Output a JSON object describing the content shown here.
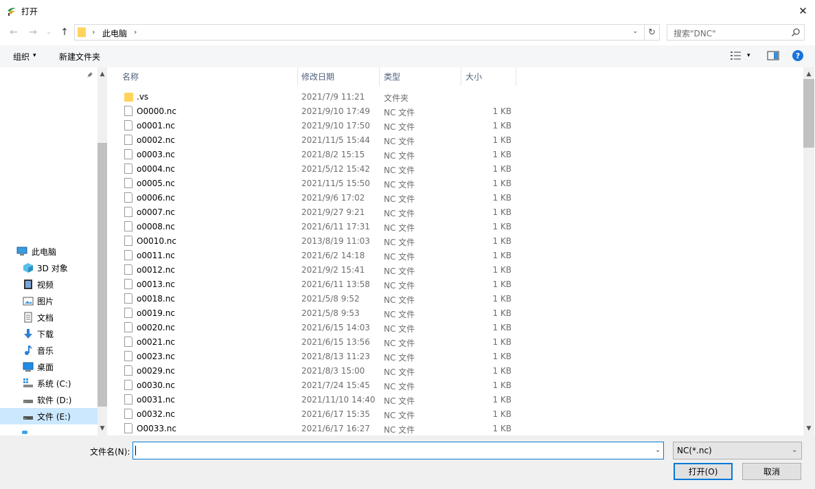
{
  "window": {
    "title": "打开",
    "close": "✕"
  },
  "nav_buttons": {
    "back": "←",
    "forward": "→",
    "recent": "⌄",
    "up": "↑"
  },
  "address": {
    "chevron": "›",
    "crumb": "此电脑",
    "dropdown": "⌄",
    "refresh": "↻"
  },
  "search": {
    "placeholder": "搜索\"DNC\""
  },
  "toolbar": {
    "organize": "组织",
    "organize_caret": "▾",
    "new_folder": "新建文件夹",
    "view_caret": "▾",
    "help": "?"
  },
  "nav_pane": {
    "pin": "📌",
    "scroll_up": "▲",
    "scroll_down": "▼",
    "items": [
      {
        "label": "此电脑",
        "icon": "computer-icon"
      },
      {
        "label": "3D 对象",
        "icon": "3d-objects-icon"
      },
      {
        "label": "视频",
        "icon": "video-icon"
      },
      {
        "label": "图片",
        "icon": "pictures-icon"
      },
      {
        "label": "文档",
        "icon": "documents-icon"
      },
      {
        "label": "下载",
        "icon": "download-icon"
      },
      {
        "label": "音乐",
        "icon": "music-icon"
      },
      {
        "label": "桌面",
        "icon": "desktop-icon"
      },
      {
        "label": "系统 (C:)",
        "icon": "system-drive-icon"
      },
      {
        "label": "软件 (D:)",
        "icon": "drive-icon"
      },
      {
        "label": "文件 (E:)",
        "icon": "drive-icon",
        "selected": true
      }
    ]
  },
  "columns": {
    "name": "名称",
    "date": "修改日期",
    "type": "类型",
    "size": "大小",
    "sort_arrow": "^"
  },
  "files": [
    {
      "name": ".vs",
      "date": "2021/7/9 11:21",
      "type": "文件夹",
      "size": "",
      "folder": true
    },
    {
      "name": "O0000.nc",
      "date": "2021/9/10 17:49",
      "type": "NC 文件",
      "size": "1 KB"
    },
    {
      "name": "o0001.nc",
      "date": "2021/9/10 17:50",
      "type": "NC 文件",
      "size": "1 KB"
    },
    {
      "name": "o0002.nc",
      "date": "2021/11/5 15:44",
      "type": "NC 文件",
      "size": "1 KB"
    },
    {
      "name": "o0003.nc",
      "date": "2021/8/2 15:15",
      "type": "NC 文件",
      "size": "1 KB"
    },
    {
      "name": "o0004.nc",
      "date": "2021/5/12 15:42",
      "type": "NC 文件",
      "size": "1 KB"
    },
    {
      "name": "o0005.nc",
      "date": "2021/11/5 15:50",
      "type": "NC 文件",
      "size": "1 KB"
    },
    {
      "name": "o0006.nc",
      "date": "2021/9/6 17:02",
      "type": "NC 文件",
      "size": "1 KB"
    },
    {
      "name": "o0007.nc",
      "date": "2021/9/27 9:21",
      "type": "NC 文件",
      "size": "1 KB"
    },
    {
      "name": "o0008.nc",
      "date": "2021/6/11 17:31",
      "type": "NC 文件",
      "size": "1 KB"
    },
    {
      "name": "O0010.nc",
      "date": "2013/8/19 11:03",
      "type": "NC 文件",
      "size": "1 KB"
    },
    {
      "name": "o0011.nc",
      "date": "2021/6/2 14:18",
      "type": "NC 文件",
      "size": "1 KB"
    },
    {
      "name": "o0012.nc",
      "date": "2021/9/2 15:41",
      "type": "NC 文件",
      "size": "1 KB"
    },
    {
      "name": "o0013.nc",
      "date": "2021/6/11 13:58",
      "type": "NC 文件",
      "size": "1 KB"
    },
    {
      "name": "o0018.nc",
      "date": "2021/5/8 9:52",
      "type": "NC 文件",
      "size": "1 KB"
    },
    {
      "name": "o0019.nc",
      "date": "2021/5/8 9:53",
      "type": "NC 文件",
      "size": "1 KB"
    },
    {
      "name": "o0020.nc",
      "date": "2021/6/15 14:03",
      "type": "NC 文件",
      "size": "1 KB"
    },
    {
      "name": "o0021.nc",
      "date": "2021/6/15 13:56",
      "type": "NC 文件",
      "size": "1 KB"
    },
    {
      "name": "o0023.nc",
      "date": "2021/8/13 11:23",
      "type": "NC 文件",
      "size": "1 KB"
    },
    {
      "name": "o0029.nc",
      "date": "2021/8/3 15:00",
      "type": "NC 文件",
      "size": "1 KB"
    },
    {
      "name": "o0030.nc",
      "date": "2021/7/24 15:45",
      "type": "NC 文件",
      "size": "1 KB"
    },
    {
      "name": "o0031.nc",
      "date": "2021/11/10 14:40",
      "type": "NC 文件",
      "size": "1 KB"
    },
    {
      "name": "o0032.nc",
      "date": "2021/6/17 15:35",
      "type": "NC 文件",
      "size": "1 KB"
    },
    {
      "name": "O0033.nc",
      "date": "2021/6/17 16:27",
      "type": "NC 文件",
      "size": "1 KB"
    }
  ],
  "list_scroll": {
    "up": "▲",
    "down": "▼"
  },
  "bottom": {
    "filename_label": "文件名(N):",
    "filename_value": "",
    "filename_dropdown": "⌄",
    "filetype": "NC(*.nc)",
    "filetype_caret": "⌄",
    "open": "打开(O)",
    "cancel": "取消"
  },
  "colors": {
    "accent": "#0078d7",
    "selected_bg": "#cce8ff",
    "folder": "#ffd35c",
    "help": "#1a73d9"
  }
}
